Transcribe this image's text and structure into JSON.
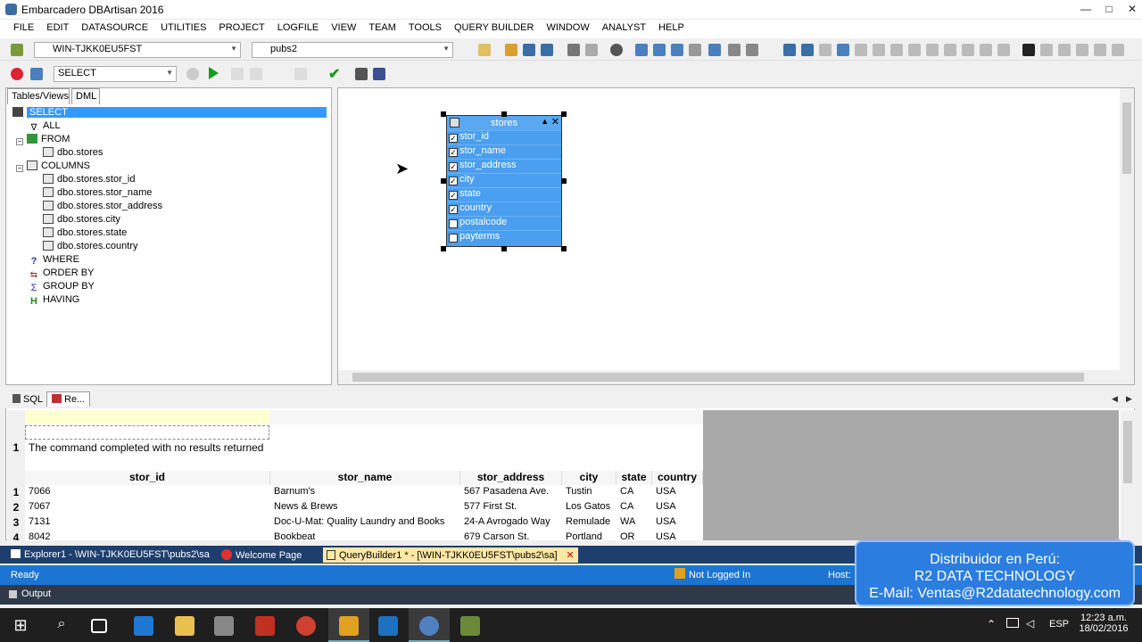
{
  "window": {
    "title": "Embarcadero DBArtisan 2016",
    "min": "—",
    "max": "□",
    "close": "✕"
  },
  "menu": [
    "FILE",
    "EDIT",
    "DATASOURCE",
    "UTILITIES",
    "PROJECT",
    "LOGFILE",
    "VIEW",
    "TEAM",
    "TOOLS",
    "QUERY BUILDER",
    "WINDOW",
    "ANALYST",
    "HELP"
  ],
  "toolbar": {
    "datasource": "WIN-TJKK0EU5FST",
    "database": "pubs2",
    "statement_type": "SELECT"
  },
  "left_tabs": [
    "Tables/Views",
    "DML"
  ],
  "tree": {
    "root": "SELECT",
    "all": "ALL",
    "from": "FROM",
    "from_table": "dbo.stores",
    "columns": "COLUMNS",
    "column_items": [
      "dbo.stores.stor_id",
      "dbo.stores.stor_name",
      "dbo.stores.stor_address",
      "dbo.stores.city",
      "dbo.stores.state",
      "dbo.stores.country"
    ],
    "where": "WHERE",
    "order_by": "ORDER BY",
    "group_by": "GROUP BY",
    "having": "HAVING"
  },
  "table_box": {
    "title": "stores",
    "columns": [
      {
        "name": "stor_id",
        "checked": true
      },
      {
        "name": "stor_name",
        "checked": true
      },
      {
        "name": "stor_address",
        "checked": true
      },
      {
        "name": "city",
        "checked": true
      },
      {
        "name": "state",
        "checked": true
      },
      {
        "name": "country",
        "checked": true
      },
      {
        "name": "postalcode",
        "checked": false
      },
      {
        "name": "payterms",
        "checked": false
      }
    ]
  },
  "bottom_tabs": [
    "SQL",
    "Re..."
  ],
  "results": {
    "message_row_num": "1",
    "message": "The command completed with no results returned",
    "headers": [
      "stor_id",
      "stor_name",
      "stor_address",
      "city",
      "state",
      "country"
    ],
    "rows": [
      {
        "n": "1",
        "cells": [
          "7066",
          "Barnum's",
          "567 Pasadena Ave.",
          "Tustin",
          "CA",
          "USA"
        ]
      },
      {
        "n": "2",
        "cells": [
          "7067",
          "News & Brews",
          "577 First St.",
          "Los Gatos",
          "CA",
          "USA"
        ]
      },
      {
        "n": "3",
        "cells": [
          "7131",
          "Doc-U-Mat: Quality Laundry and Books",
          "24-A Avrogado Way",
          "Remulade",
          "WA",
          "USA"
        ]
      },
      {
        "n": "4",
        "cells": [
          "8042",
          "Bookbeat",
          "679 Carson St.",
          "Portland",
          "OR",
          "USA"
        ]
      }
    ]
  },
  "doc_tabs": [
    "Explorer1 - \\WIN-TJKK0EU5FST\\pubs2\\sa",
    "Welcome Page",
    "QueryBuilder1 * - [\\WIN-TJKK0EU5FST\\pubs2\\sa]"
  ],
  "status": {
    "ready": "Ready",
    "login": "Not Logged In",
    "host": "Host:"
  },
  "output_label": "Output",
  "promo": {
    "line1": "Distribuidor en Perú:",
    "line2": "R2 DATA TECHNOLOGY",
    "line3": "E-Mail: Ventas@R2datatechnology.com"
  },
  "taskbar": {
    "lang": "ESP",
    "time": "12:23 a.m.",
    "date": "18/02/2016"
  }
}
